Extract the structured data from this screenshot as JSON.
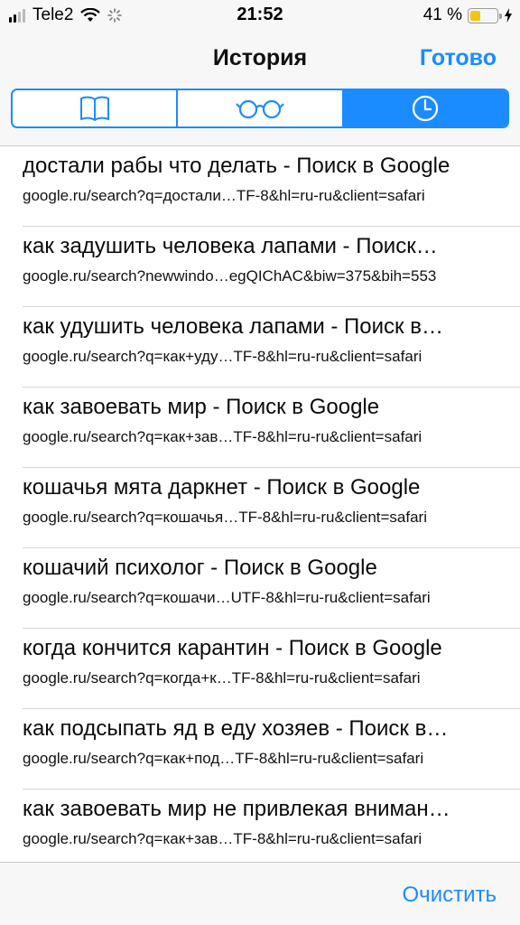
{
  "status_bar": {
    "carrier": "Tele2",
    "time": "21:52",
    "battery_percent": "41 %",
    "battery_level": 0.41,
    "signal_bars_on": 2,
    "signal_bars_total": 4
  },
  "nav": {
    "title": "История",
    "done_label": "Готово"
  },
  "segments": [
    {
      "icon": "bookmarks-book-icon",
      "active": false
    },
    {
      "icon": "reading-list-glasses-icon",
      "active": false
    },
    {
      "icon": "history-clock-icon",
      "active": true
    }
  ],
  "history": [
    {
      "title": "достали рабы что делать - Поиск в Google",
      "url": "google.ru/search?q=достали…TF-8&hl=ru-ru&client=safari"
    },
    {
      "title": "как задушить человека лапами - Поиск…",
      "url": "google.ru/search?newwindo…egQIChAC&biw=375&bih=553"
    },
    {
      "title": "как удушить человека лапами - Поиск в…",
      "url": "google.ru/search?q=как+уду…TF-8&hl=ru-ru&client=safari"
    },
    {
      "title": "как завоевать мир - Поиск в Google",
      "url": "google.ru/search?q=как+зав…TF-8&hl=ru-ru&client=safari"
    },
    {
      "title": "кошачья мята даркнет - Поиск в Google",
      "url": "google.ru/search?q=кошачья…TF-8&hl=ru-ru&client=safari"
    },
    {
      "title": "кошачий психолог - Поиск в Google",
      "url": "google.ru/search?q=кошачи…UTF-8&hl=ru-ru&client=safari"
    },
    {
      "title": "когда кончится карантин - Поиск в Google",
      "url": "google.ru/search?q=когда+к…TF-8&hl=ru-ru&client=safari"
    },
    {
      "title": "как подсыпать яд в еду хозяев - Поиск в…",
      "url": "google.ru/search?q=как+под…TF-8&hl=ru-ru&client=safari"
    },
    {
      "title": "как завоевать мир не привлекая вниман…",
      "url": "google.ru/search?q=как+зав…TF-8&hl=ru-ru&client=safari"
    }
  ],
  "toolbar": {
    "clear_label": "Очистить"
  },
  "colors": {
    "accent": "#1a8cff",
    "battery": "#f5c317"
  }
}
